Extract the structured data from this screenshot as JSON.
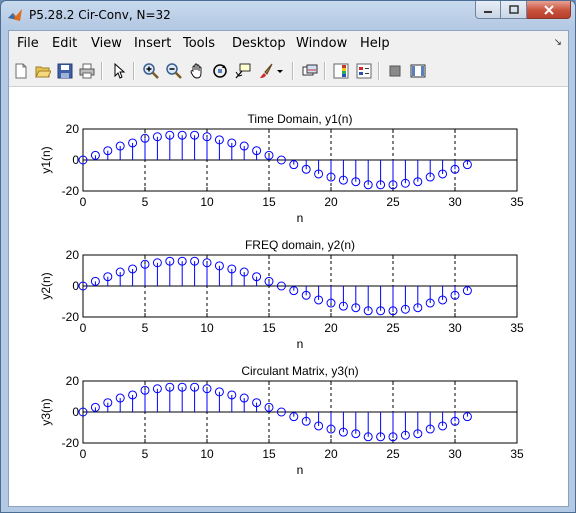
{
  "window": {
    "title": "P5.28.2 Cir-Conv, N=32",
    "buttons": [
      "minimize",
      "maximize",
      "close"
    ]
  },
  "menu": {
    "items": [
      "File",
      "Edit",
      "View",
      "Insert",
      "Tools",
      "Desktop",
      "Window",
      "Help"
    ],
    "dock_arrow": "↘"
  },
  "toolbar": {
    "icons": [
      "new-figure-icon",
      "open-file-icon",
      "save-icon",
      "print-icon",
      "edit-plot-icon",
      "zoom-in-icon",
      "zoom-out-icon",
      "pan-icon",
      "rotate-3d-icon",
      "data-cursor-icon",
      "brush-icon",
      "brush-dropdown-icon",
      "link-plot-icon",
      "colorbar-icon",
      "legend-icon",
      "hide-plot-tools-icon",
      "show-plot-tools-icon"
    ]
  },
  "colors": {
    "stem": "#0000ff",
    "axes": "#000000",
    "background": "#ffffff"
  },
  "chart_data": [
    {
      "type": "stem",
      "title": "Time Domain, y1(n)",
      "xlabel": "n",
      "ylabel": "y1(n)",
      "xlim": [
        0,
        35
      ],
      "ylim": [
        -20,
        20
      ],
      "xticks": [
        "0",
        "5",
        "10",
        "15",
        "20",
        "25",
        "30",
        "35"
      ],
      "yticks": [
        "20",
        "0",
        "-20"
      ],
      "grid": "x-dashed",
      "x": [
        0,
        1,
        2,
        3,
        4,
        5,
        6,
        7,
        8,
        9,
        10,
        11,
        12,
        13,
        14,
        15,
        16,
        17,
        18,
        19,
        20,
        21,
        22,
        23,
        24,
        25,
        26,
        27,
        28,
        29,
        30,
        31
      ],
      "y": [
        0,
        3,
        6,
        9,
        11,
        14,
        15,
        16,
        16,
        16,
        15,
        13,
        11,
        9,
        6,
        3,
        0,
        -3,
        -6,
        -9,
        -11,
        -13,
        -14,
        -16,
        -16,
        -16,
        -15,
        -14,
        -11,
        -9,
        -6,
        -3
      ]
    },
    {
      "type": "stem",
      "title": "FREQ domain, y2(n)",
      "xlabel": "n",
      "ylabel": "y2(n)",
      "xlim": [
        0,
        35
      ],
      "ylim": [
        -20,
        20
      ],
      "xticks": [
        "0",
        "5",
        "10",
        "15",
        "20",
        "25",
        "30",
        "35"
      ],
      "yticks": [
        "20",
        "0",
        "-20"
      ],
      "grid": "x-dashed",
      "x": [
        0,
        1,
        2,
        3,
        4,
        5,
        6,
        7,
        8,
        9,
        10,
        11,
        12,
        13,
        14,
        15,
        16,
        17,
        18,
        19,
        20,
        21,
        22,
        23,
        24,
        25,
        26,
        27,
        28,
        29,
        30,
        31
      ],
      "y": [
        0,
        3,
        6,
        9,
        11,
        14,
        15,
        16,
        16,
        16,
        15,
        13,
        11,
        9,
        6,
        3,
        0,
        -3,
        -6,
        -9,
        -11,
        -13,
        -14,
        -16,
        -16,
        -16,
        -15,
        -14,
        -11,
        -9,
        -6,
        -3
      ]
    },
    {
      "type": "stem",
      "title": "Circulant Matrix, y3(n)",
      "xlabel": "n",
      "ylabel": "y3(n)",
      "xlim": [
        0,
        35
      ],
      "ylim": [
        -20,
        20
      ],
      "xticks": [
        "0",
        "5",
        "10",
        "15",
        "20",
        "25",
        "30",
        "35"
      ],
      "yticks": [
        "20",
        "0",
        "-20"
      ],
      "grid": "x-dashed",
      "x": [
        0,
        1,
        2,
        3,
        4,
        5,
        6,
        7,
        8,
        9,
        10,
        11,
        12,
        13,
        14,
        15,
        16,
        17,
        18,
        19,
        20,
        21,
        22,
        23,
        24,
        25,
        26,
        27,
        28,
        29,
        30,
        31
      ],
      "y": [
        0,
        3,
        6,
        9,
        11,
        14,
        15,
        16,
        16,
        16,
        15,
        13,
        11,
        9,
        6,
        3,
        0,
        -3,
        -6,
        -9,
        -11,
        -13,
        -14,
        -16,
        -16,
        -16,
        -15,
        -14,
        -11,
        -9,
        -6,
        -3
      ]
    }
  ]
}
